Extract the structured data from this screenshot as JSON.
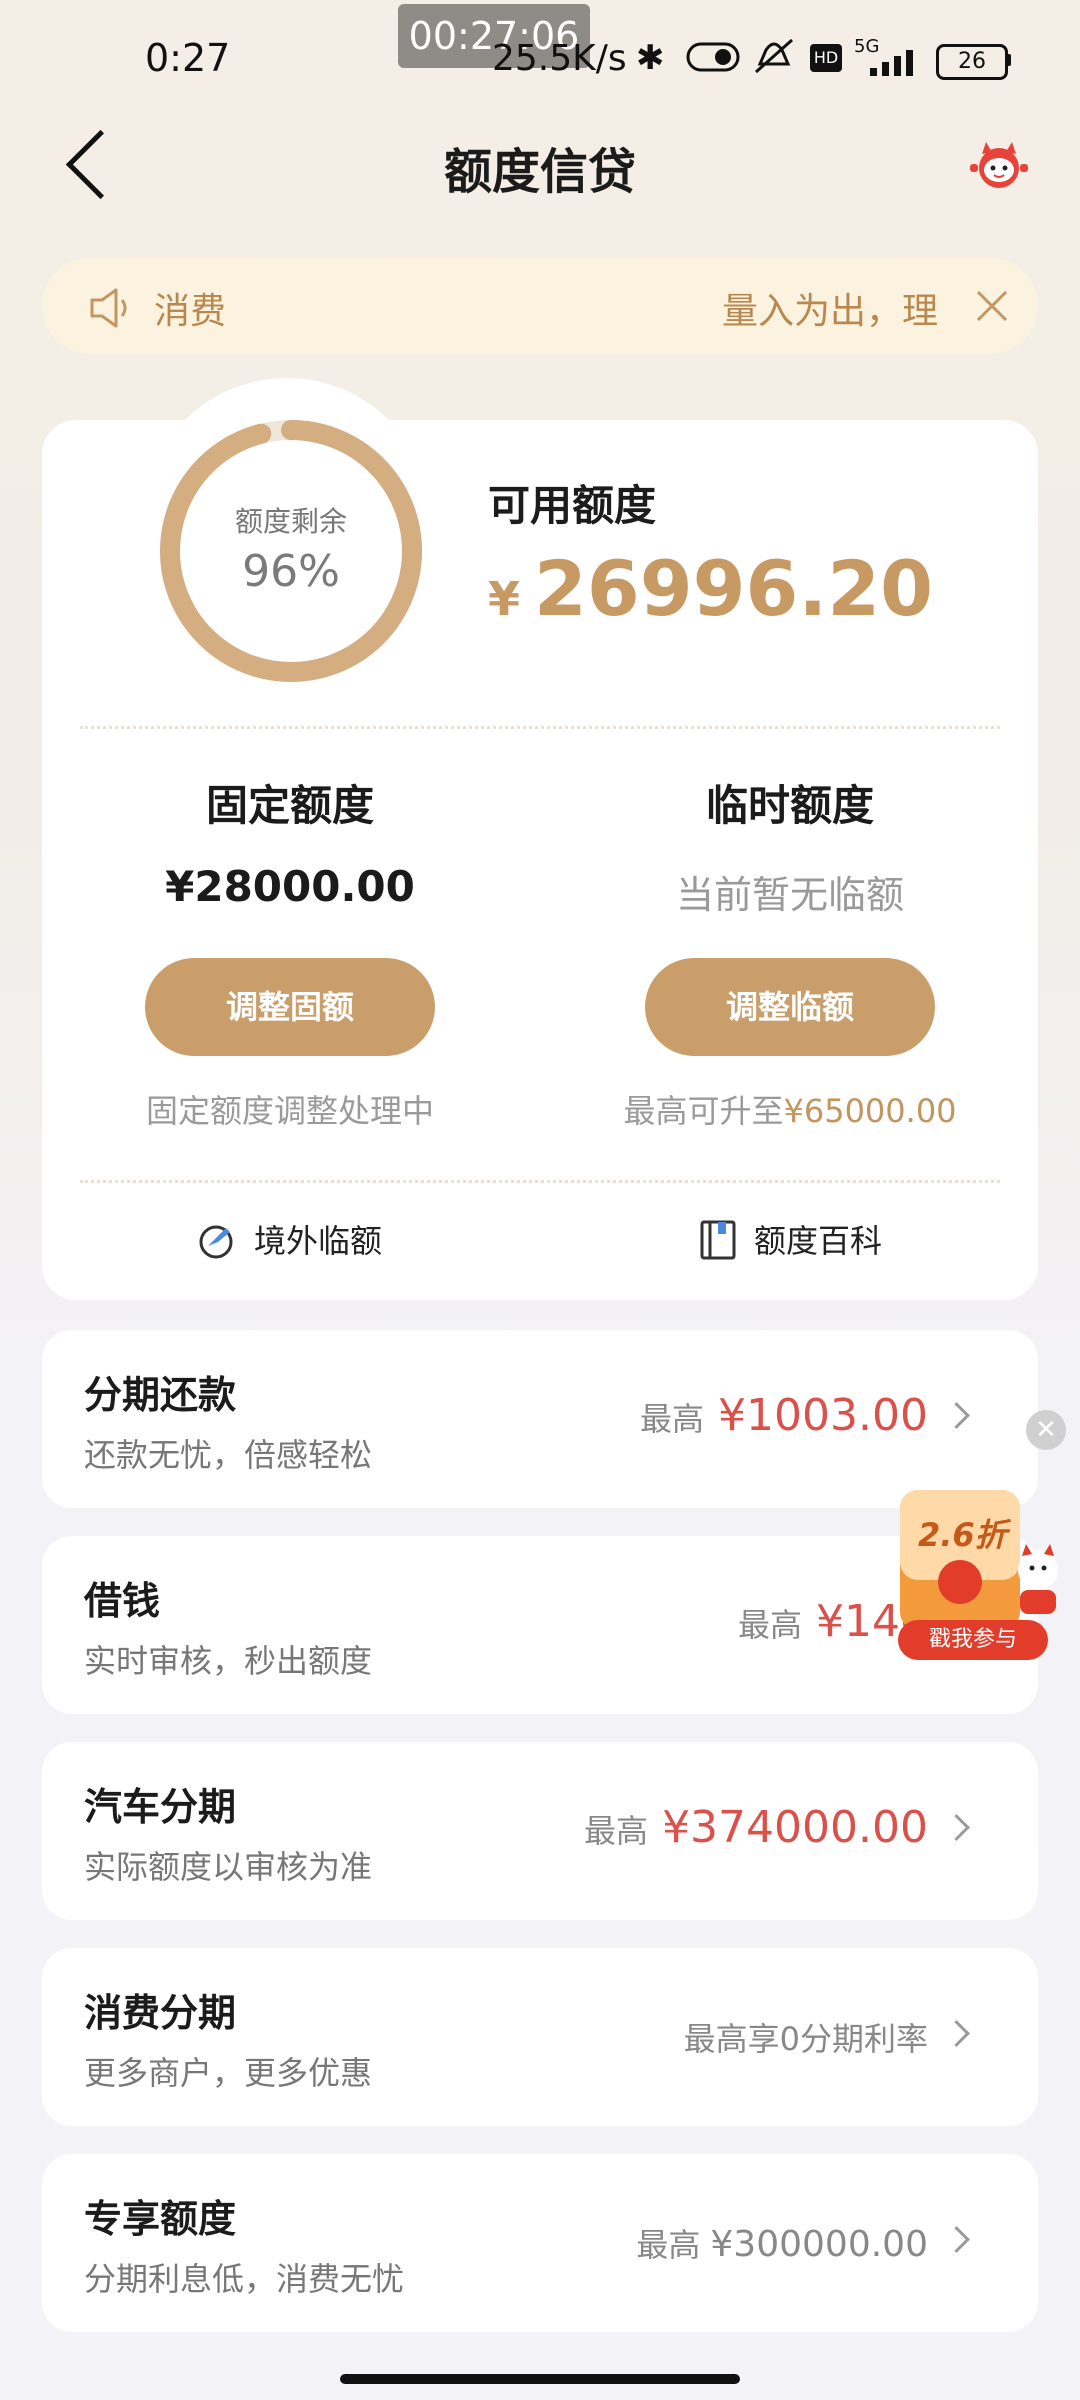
{
  "status_bar": {
    "time": "0:27",
    "recording": "00:27:06",
    "net_speed": "25.5K/s",
    "network": "5G",
    "hd": "HD",
    "battery": "26"
  },
  "header": {
    "title": "额度信贷"
  },
  "notice": {
    "label": "消费",
    "text": "量入为出，理"
  },
  "credit": {
    "ring_label": "额度剩余",
    "ring_percent": "96%",
    "ring_fraction": 0.96,
    "available_label": "可用额度",
    "currency": "¥",
    "available_amount": "26996.20",
    "fixed": {
      "title": "固定额度",
      "amount": "¥28000.00",
      "button": "调整固额",
      "note": "固定额度调整处理中"
    },
    "temporary": {
      "title": "临时额度",
      "status": "当前暂无临额",
      "button": "调整临额",
      "note_prefix": "最高可升至",
      "note_amount": "¥65000.00"
    },
    "links": {
      "overseas": "境外临额",
      "wiki": "额度百科"
    }
  },
  "products": [
    {
      "title": "分期还款",
      "subtitle": "还款无忧，倍感轻松",
      "prefix": "最高",
      "value": "¥1003.00"
    },
    {
      "title": "借钱",
      "subtitle": "实时审核，秒出额度",
      "prefix": "最高",
      "value": "¥140"
    },
    {
      "title": "汽车分期",
      "subtitle": "实际额度以审核为准",
      "prefix": "最高",
      "value": "¥374000.00"
    },
    {
      "title": "消费分期",
      "subtitle": "更多商户，更多优惠",
      "prefix": "最高享0分期利率",
      "value": ""
    },
    {
      "title": "专享额度",
      "subtitle": "分期利息低，消费无忧",
      "prefix": "最高",
      "value": "¥300000.00"
    }
  ],
  "promo": {
    "discount": "2.6折",
    "cta": "戳我参与"
  },
  "colors": {
    "accent_gold": "#c99e6b",
    "amount_red": "#d9514a",
    "notice_bg": "#fbf3df"
  }
}
